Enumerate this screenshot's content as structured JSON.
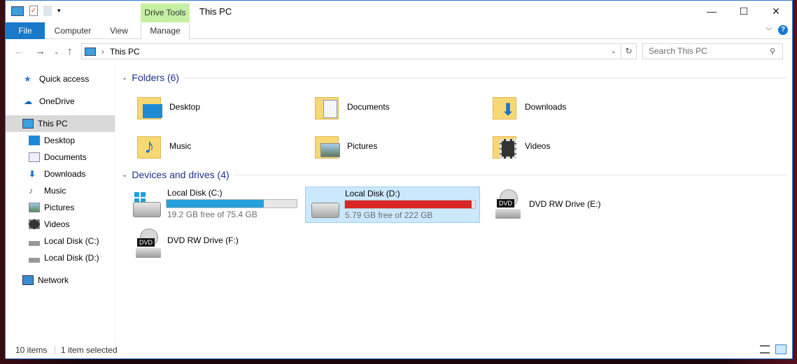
{
  "window": {
    "title": "This PC",
    "context_tab_group": "Drive Tools",
    "controls": {
      "minimize": "—",
      "maximize": "☐",
      "close": "✕"
    }
  },
  "ribbon": {
    "tabs": [
      "File",
      "Computer",
      "View",
      "Manage"
    ],
    "help": "?"
  },
  "address": {
    "path": "This PC",
    "search_placeholder": "Search This PC"
  },
  "sidebar": {
    "items": [
      {
        "label": "Quick access",
        "icon": "star-icon",
        "level": 0
      },
      {
        "label": "OneDrive",
        "icon": "cloud-icon",
        "level": 0
      },
      {
        "label": "This PC",
        "icon": "computer-icon",
        "level": 0,
        "selected": true
      },
      {
        "label": "Desktop",
        "icon": "desktop-icon",
        "level": 1
      },
      {
        "label": "Documents",
        "icon": "documents-icon",
        "level": 1
      },
      {
        "label": "Downloads",
        "icon": "download-icon",
        "level": 1
      },
      {
        "label": "Music",
        "icon": "music-icon",
        "level": 1
      },
      {
        "label": "Pictures",
        "icon": "pictures-icon",
        "level": 1
      },
      {
        "label": "Videos",
        "icon": "videos-icon",
        "level": 1
      },
      {
        "label": "Local Disk (C:)",
        "icon": "drive-icon",
        "level": 1
      },
      {
        "label": "Local Disk (D:)",
        "icon": "drive-icon",
        "level": 1
      },
      {
        "label": "Network",
        "icon": "network-icon",
        "level": 0
      }
    ]
  },
  "folders": {
    "header": "Folders (6)",
    "items": [
      "Desktop",
      "Documents",
      "Downloads",
      "Music",
      "Pictures",
      "Videos"
    ]
  },
  "devices": {
    "header": "Devices and drives (4)",
    "items": [
      {
        "name": "Local Disk (C:)",
        "free": "19.2 GB free of 75.4 GB",
        "used_fraction": 0.745,
        "bar_color": "#26a0da"
      },
      {
        "name": "Local Disk (D:)",
        "free": "5.79 GB free of 222 GB",
        "used_fraction": 0.974,
        "bar_color": "#da2626",
        "selected": true
      },
      {
        "name": "DVD RW Drive (E:)",
        "badge": "DVD"
      },
      {
        "name": "DVD RW Drive (F:)",
        "badge": "DVD"
      }
    ]
  },
  "status": {
    "items": "10 items",
    "selected": "1 item selected"
  }
}
